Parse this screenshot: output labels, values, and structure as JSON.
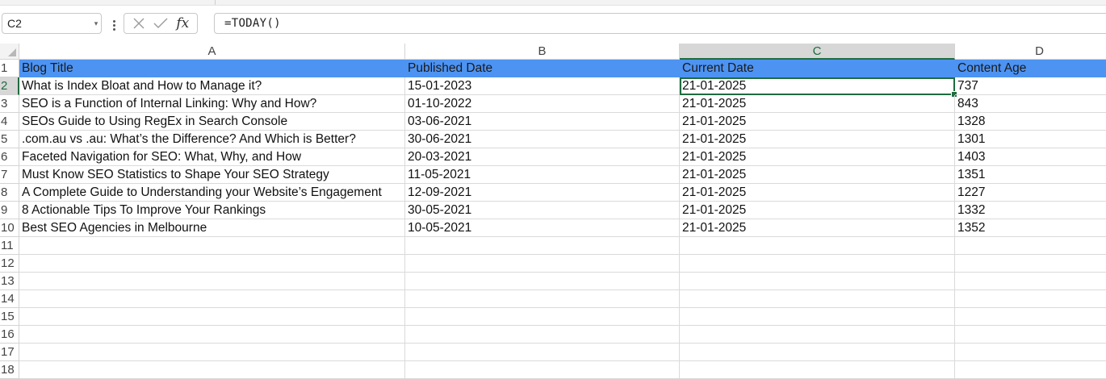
{
  "name_box": {
    "value": "C2"
  },
  "formula_bar": {
    "fx_label": "fx",
    "formula": "=TODAY()"
  },
  "colors": {
    "header_fill": "#4d93f2",
    "selection": "#1e6c3f"
  },
  "sheet": {
    "columns": [
      "A",
      "B",
      "C",
      "D"
    ],
    "selected_column": "C",
    "selected_row": "2",
    "row_numbers": [
      "1",
      "2",
      "3",
      "4",
      "5",
      "6",
      "7",
      "8",
      "9",
      "10",
      "11",
      "12",
      "13",
      "14",
      "15",
      "16",
      "17",
      "18"
    ],
    "header": [
      "Blog Title",
      "Published Date",
      "Current Date",
      "Content Age"
    ],
    "rows": [
      [
        "What is Index Bloat and How to Manage it?",
        "15-01-2023",
        "21-01-2025",
        "737"
      ],
      [
        "SEO is a Function of Internal Linking: Why and How?",
        "01-10-2022",
        "21-01-2025",
        "843"
      ],
      [
        "SEOs Guide to Using RegEx in Search Console",
        "03-06-2021",
        "21-01-2025",
        "1328"
      ],
      [
        ".com.au vs .au: What’s the Difference? And Which is Better?",
        "30-06-2021",
        "21-01-2025",
        "1301"
      ],
      [
        "Faceted Navigation for SEO: What, Why, and How",
        "20-03-2021",
        "21-01-2025",
        "1403"
      ],
      [
        "Must Know SEO Statistics to Shape Your SEO Strategy",
        "11-05-2021",
        "21-01-2025",
        "1351"
      ],
      [
        "A Complete Guide to Understanding your Website’s Engagement",
        "12-09-2021",
        "21-01-2025",
        "1227"
      ],
      [
        "8 Actionable Tips To Improve Your Rankings",
        "30-05-2021",
        "21-01-2025",
        "1332"
      ],
      [
        "Best SEO Agencies in Melbourne",
        "10-05-2021",
        "21-01-2025",
        "1352"
      ]
    ]
  }
}
